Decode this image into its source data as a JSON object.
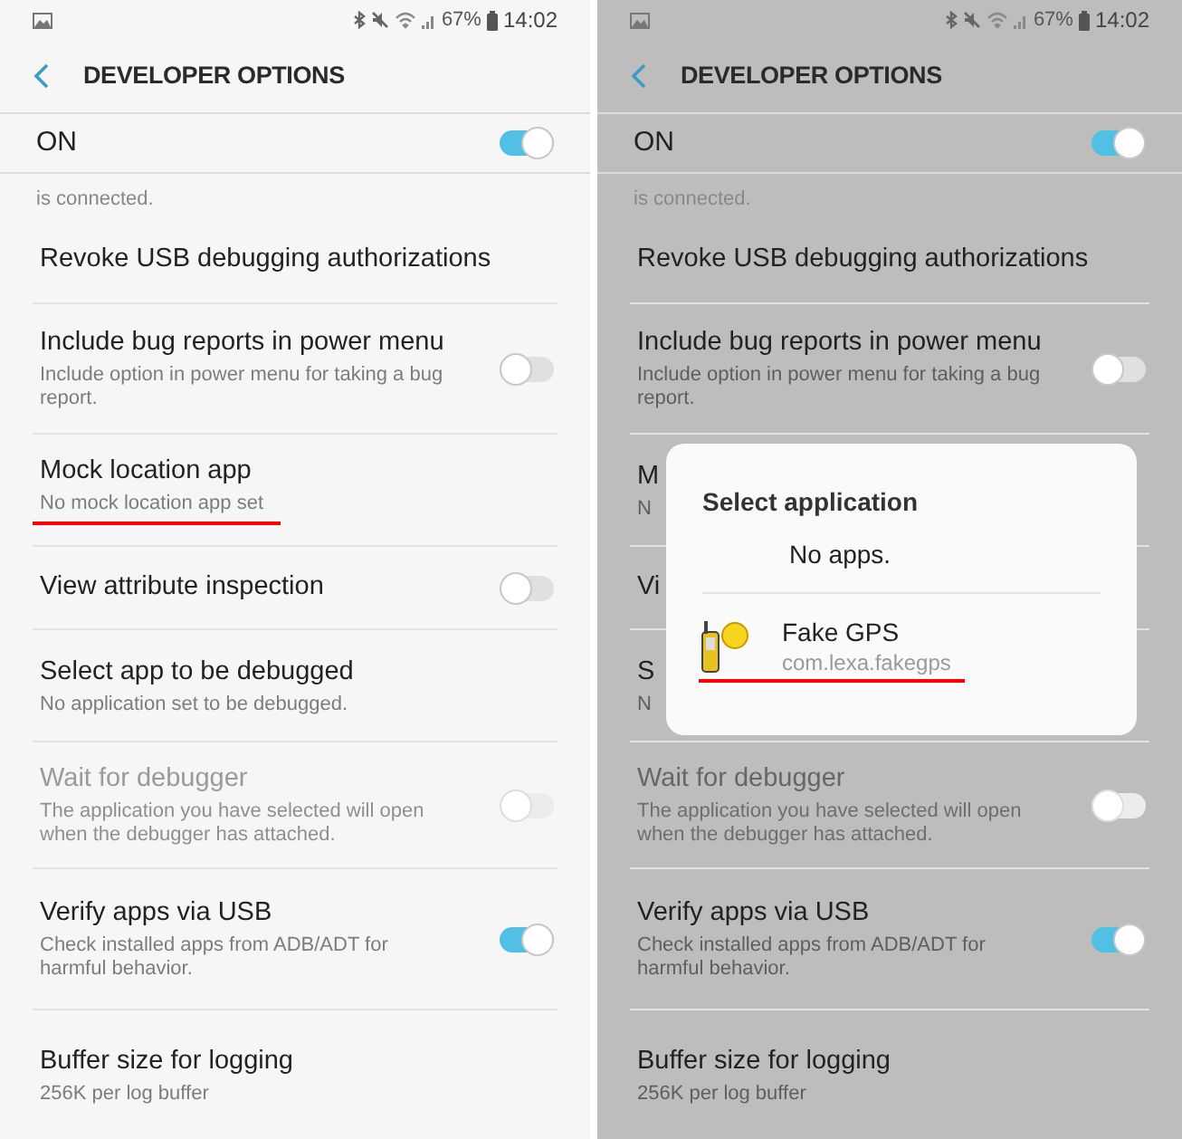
{
  "screens": [
    {
      "status_bar": {
        "battery": "67%",
        "time": "14:02"
      },
      "header": {
        "title": "DEVELOPER OPTIONS"
      },
      "master": {
        "label": "ON",
        "on": true
      },
      "cut_text": "is connected.",
      "dimmed": false,
      "rows": [
        {
          "kind": "text",
          "title": "Revoke USB debugging authorizations",
          "disabled": false,
          "underlined": false
        },
        {
          "kind": "toggle",
          "title": "Include bug reports in power menu",
          "subtitle": "Include option in power menu for taking a bug report.",
          "on": false,
          "disabled": false,
          "underlined": false
        },
        {
          "kind": "text",
          "title": "Mock location app",
          "subtitle": "No mock location app set",
          "disabled": false,
          "underlined": true
        },
        {
          "kind": "toggle",
          "title": "View attribute inspection",
          "on": false,
          "disabled": false,
          "underlined": false
        },
        {
          "kind": "text",
          "title": "Select app to be debugged",
          "subtitle": "No application set to be debugged.",
          "disabled": false,
          "underlined": false
        },
        {
          "kind": "toggle",
          "title": "Wait for debugger",
          "subtitle": "The application you have selected will open when the debugger has attached.",
          "on": false,
          "disabled": true,
          "underlined": false
        },
        {
          "kind": "toggle",
          "title": "Verify apps via USB",
          "subtitle": "Check installed apps from ADB/ADT for harmful behavior.",
          "on": true,
          "disabled": false,
          "underlined": false
        },
        {
          "kind": "text",
          "title": "Buffer size for logging",
          "subtitle": "256K per log buffer",
          "disabled": false,
          "underlined": false
        }
      ]
    },
    {
      "status_bar": {
        "battery": "67%",
        "time": "14:02"
      },
      "header": {
        "title": "DEVELOPER OPTIONS"
      },
      "master": {
        "label": "ON",
        "on": true
      },
      "cut_text": "is connected.",
      "dimmed": true,
      "rows": [
        {
          "kind": "text",
          "title": "Revoke USB debugging authorizations",
          "disabled": false,
          "underlined": false
        },
        {
          "kind": "toggle",
          "title": "Include bug reports in power menu",
          "subtitle": "Include option in power menu for taking a bug report.",
          "on": false,
          "disabled": false,
          "underlined": false
        },
        {
          "kind": "text",
          "title": "M",
          "subtitle": "N",
          "disabled": false,
          "underlined": false
        },
        {
          "kind": "text",
          "title": "Vi",
          "disabled": false,
          "underlined": false
        },
        {
          "kind": "text",
          "title": "S",
          "subtitle": "N",
          "disabled": false,
          "underlined": false
        },
        {
          "kind": "toggle",
          "title": "Wait for debugger",
          "subtitle": "The application you have selected will open when the debugger has attached.",
          "on": false,
          "disabled": true,
          "underlined": false
        },
        {
          "kind": "toggle",
          "title": "Verify apps via USB",
          "subtitle": "Check installed apps from ADB/ADT for harmful behavior.",
          "on": true,
          "disabled": false,
          "underlined": false
        },
        {
          "kind": "text",
          "title": "Buffer size for logging",
          "subtitle": "256K per log buffer",
          "disabled": false,
          "underlined": false
        }
      ],
      "dialog": {
        "title": "Select application",
        "items": [
          {
            "kind": "empty",
            "label": "No apps.",
            "underlined": false
          },
          {
            "kind": "app",
            "label": "Fake GPS",
            "package": "com.lexa.fakegps",
            "underlined": true
          }
        ]
      }
    }
  ]
}
